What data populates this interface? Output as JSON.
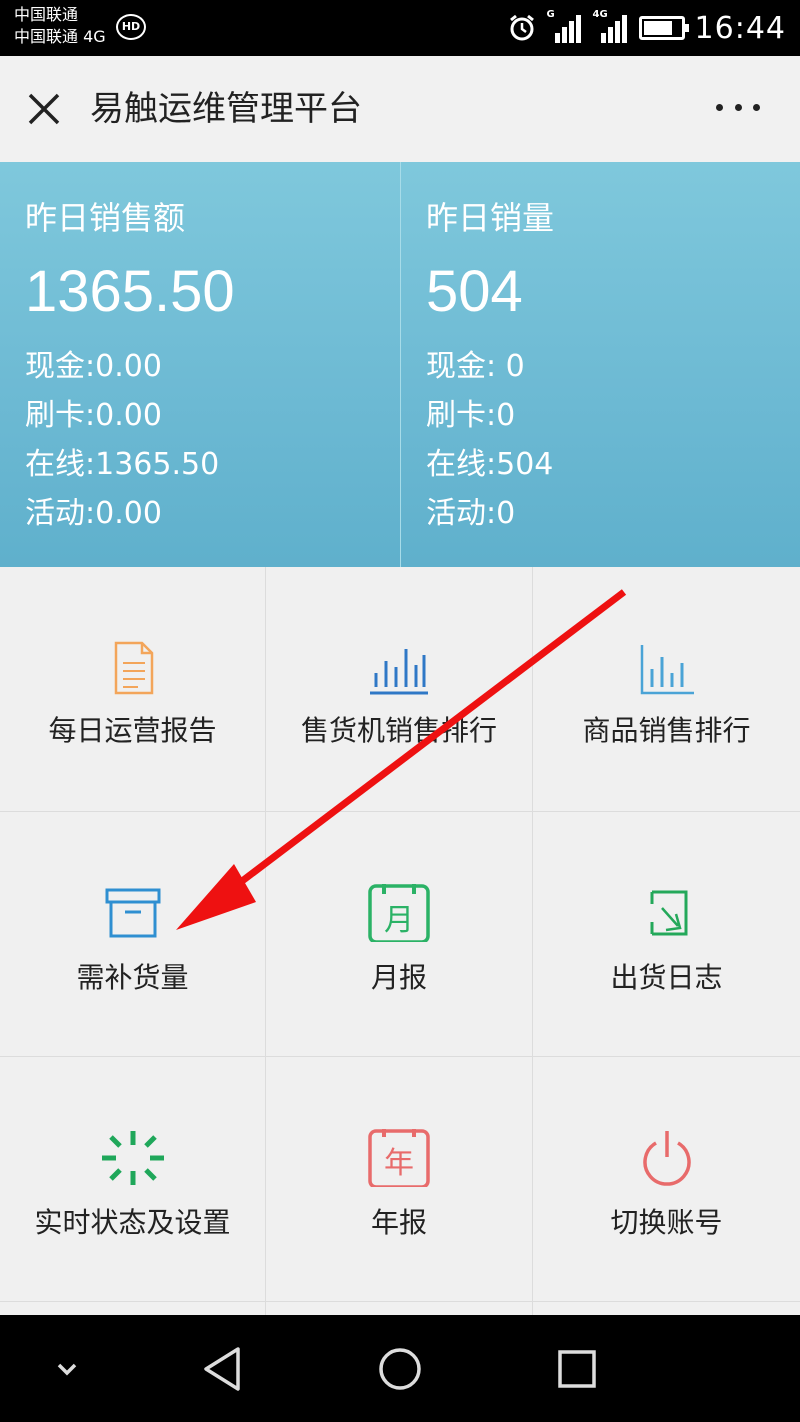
{
  "status_bar": {
    "carrier_1": "中国联通",
    "carrier_2": "中国联通 4G",
    "hd_badge": "HD",
    "signal_1_label": "G",
    "signal_2_label": "4G",
    "battery_level": 0.78,
    "time": "16:44"
  },
  "header": {
    "title": "易触运维管理平台"
  },
  "stats": {
    "sales_amount": {
      "label": "昨日销售额",
      "value": "1365.50",
      "cash": "现金:0.00",
      "card": "刷卡:0.00",
      "online": "在线:1365.50",
      "promo": "活动:0.00"
    },
    "sales_volume": {
      "label": "昨日销量",
      "value": "504",
      "cash": "现金: 0",
      "card": "刷卡:0",
      "online": "在线:504",
      "promo": "活动:0"
    }
  },
  "grid": {
    "items": [
      {
        "label": "每日运营报告",
        "icon": "document-icon",
        "color": "#f3a55a"
      },
      {
        "label": "售货机销售排行",
        "icon": "bar-chart-icon",
        "color": "#2f78c6"
      },
      {
        "label": "商品销售排行",
        "icon": "bar-chart-icon",
        "color": "#4aa3d6"
      },
      {
        "label": "需补货量",
        "icon": "box-icon",
        "color": "#2f8fd1"
      },
      {
        "label": "月报",
        "icon": "calendar-month-icon",
        "color": "#2bb266",
        "glyph": "月"
      },
      {
        "label": "出货日志",
        "icon": "log-icon",
        "color": "#24a85a"
      },
      {
        "label": "实时状态及设置",
        "icon": "loading-icon",
        "color": "#1fa75a"
      },
      {
        "label": "年报",
        "icon": "calendar-year-icon",
        "color": "#e86b6b",
        "glyph": "年"
      },
      {
        "label": "切换账号",
        "icon": "power-icon",
        "color": "#e86b6b"
      }
    ]
  },
  "annotation": {
    "arrow_color": "#ee1111"
  }
}
